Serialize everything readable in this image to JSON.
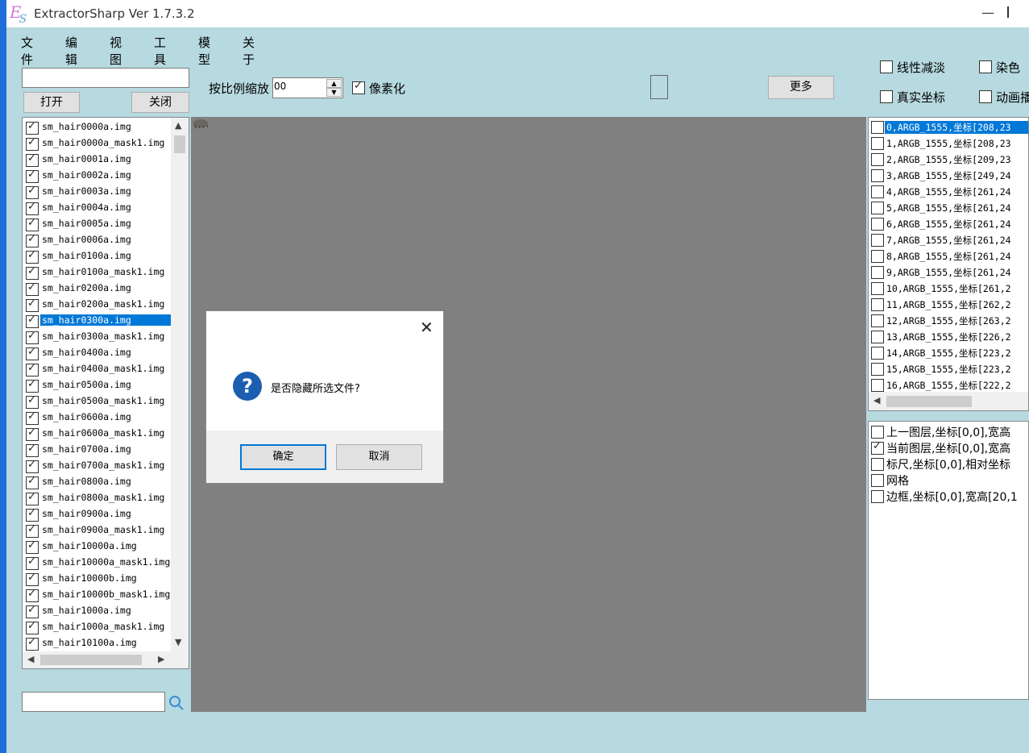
{
  "window": {
    "logo": "E",
    "logo_sub": "S",
    "title": "ExtractorSharp Ver 1.7.3.2",
    "minimize_glyph": "—"
  },
  "menu": [
    "文件",
    "编辑",
    "视图",
    "工具",
    "模型",
    "关于"
  ],
  "left": {
    "path_value": "",
    "open_label": "打开",
    "close_label": "关闭",
    "search_value": ""
  },
  "toolbar": {
    "scale_label": "按比例缩放",
    "scale_value": "00",
    "pixelate_label": "像素化",
    "pixelate_checked": true,
    "more_label": "更多",
    "linear_fade_label": "线性减淡",
    "dye_label": "染色",
    "real_coords_label": "真实坐标",
    "animation_label": "动画播"
  },
  "files": [
    {
      "name": "sm_hair0000a.img",
      "checked": true
    },
    {
      "name": "sm_hair0000a_mask1.img",
      "checked": true
    },
    {
      "name": "sm_hair0001a.img",
      "checked": true
    },
    {
      "name": "sm_hair0002a.img",
      "checked": true
    },
    {
      "name": "sm_hair0003a.img",
      "checked": true
    },
    {
      "name": "sm_hair0004a.img",
      "checked": true
    },
    {
      "name": "sm_hair0005a.img",
      "checked": true
    },
    {
      "name": "sm_hair0006a.img",
      "checked": true
    },
    {
      "name": "sm_hair0100a.img",
      "checked": true
    },
    {
      "name": "sm_hair0100a_mask1.img",
      "checked": true
    },
    {
      "name": "sm_hair0200a.img",
      "checked": true
    },
    {
      "name": "sm_hair0200a_mask1.img",
      "checked": true
    },
    {
      "name": "sm_hair0300a.img",
      "checked": true,
      "selected": true
    },
    {
      "name": "sm_hair0300a_mask1.img",
      "checked": true
    },
    {
      "name": "sm_hair0400a.img",
      "checked": true
    },
    {
      "name": "sm_hair0400a_mask1.img",
      "checked": true
    },
    {
      "name": "sm_hair0500a.img",
      "checked": true
    },
    {
      "name": "sm_hair0500a_mask1.img",
      "checked": true
    },
    {
      "name": "sm_hair0600a.img",
      "checked": true
    },
    {
      "name": "sm_hair0600a_mask1.img",
      "checked": true
    },
    {
      "name": "sm_hair0700a.img",
      "checked": true
    },
    {
      "name": "sm_hair0700a_mask1.img",
      "checked": true
    },
    {
      "name": "sm_hair0800a.img",
      "checked": true
    },
    {
      "name": "sm_hair0800a_mask1.img",
      "checked": true
    },
    {
      "name": "sm_hair0900a.img",
      "checked": true
    },
    {
      "name": "sm_hair0900a_mask1.img",
      "checked": true
    },
    {
      "name": "sm_hair10000a.img",
      "checked": true
    },
    {
      "name": "sm_hair10000a_mask1.img",
      "checked": true
    },
    {
      "name": "sm_hair10000b.img",
      "checked": true
    },
    {
      "name": "sm_hair10000b_mask1.img",
      "checked": true
    },
    {
      "name": "sm_hair1000a.img",
      "checked": true
    },
    {
      "name": "sm_hair1000a_mask1.img",
      "checked": true
    },
    {
      "name": "sm_hair10100a.img",
      "checked": true
    }
  ],
  "frames": [
    {
      "text": "0,ARGB_1555,坐标[208,23",
      "selected": true
    },
    {
      "text": "1,ARGB_1555,坐标[208,23"
    },
    {
      "text": "2,ARGB_1555,坐标[209,23"
    },
    {
      "text": "3,ARGB_1555,坐标[249,24"
    },
    {
      "text": "4,ARGB_1555,坐标[261,24"
    },
    {
      "text": "5,ARGB_1555,坐标[261,24"
    },
    {
      "text": "6,ARGB_1555,坐标[261,24"
    },
    {
      "text": "7,ARGB_1555,坐标[261,24"
    },
    {
      "text": "8,ARGB_1555,坐标[261,24"
    },
    {
      "text": "9,ARGB_1555,坐标[261,24"
    },
    {
      "text": "10,ARGB_1555,坐标[261,2"
    },
    {
      "text": "11,ARGB_1555,坐标[262,2"
    },
    {
      "text": "12,ARGB_1555,坐标[263,2"
    },
    {
      "text": "13,ARGB_1555,坐标[226,2"
    },
    {
      "text": "14,ARGB_1555,坐标[223,2"
    },
    {
      "text": "15,ARGB_1555,坐标[223,2"
    },
    {
      "text": "16,ARGB_1555,坐标[222,2"
    }
  ],
  "layers": [
    {
      "text": "上一图层,坐标[0,0],宽高",
      "checked": false
    },
    {
      "text": "当前图层,坐标[0,0],宽高",
      "checked": true
    },
    {
      "text": "标尺,坐标[0,0],相对坐标",
      "checked": false
    },
    {
      "text": "网格",
      "checked": false
    },
    {
      "text": "边框,坐标[0,0],宽高[20,1",
      "checked": false
    }
  ],
  "dialog": {
    "message": "是否隐藏所选文件?",
    "ok_label": "确定",
    "cancel_label": "取消",
    "close_glyph": "✕",
    "icon_glyph": "?"
  },
  "colors": {
    "background": "#b7d9e0",
    "selection": "#0078d7",
    "canvas": "#808080",
    "accent": "#1e6fd9"
  }
}
